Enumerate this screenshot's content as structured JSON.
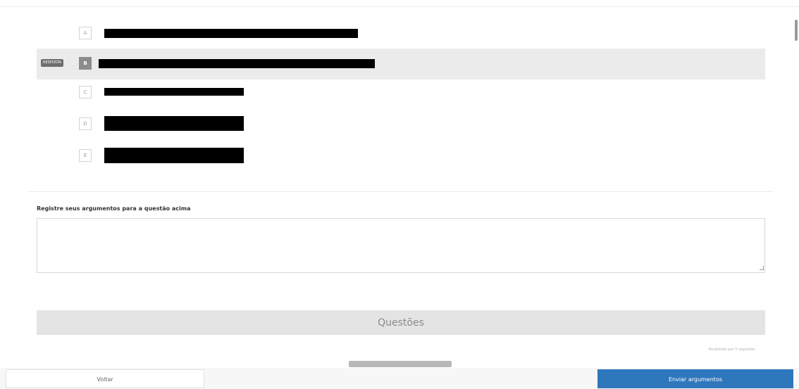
{
  "options": [
    {
      "letter": "A",
      "selected": false
    },
    {
      "letter": "B",
      "selected": true,
      "badge": "RESPOSTA"
    },
    {
      "letter": "C",
      "selected": false
    },
    {
      "letter": "D",
      "selected": false
    },
    {
      "letter": "E",
      "selected": false
    }
  ],
  "arguments": {
    "label": "Registre seus argumentos para a questão acima",
    "value": "",
    "placeholder": ""
  },
  "questions_label": "Questões",
  "save_status": "Atualizado por 5 segundos",
  "footer": {
    "back_label": "Voltar",
    "submit_label": "Enviar argumentos"
  },
  "colors": {
    "accent": "#2f77bd",
    "selected_row": "#ebebeb",
    "selected_letter": "#8c8c8c"
  }
}
